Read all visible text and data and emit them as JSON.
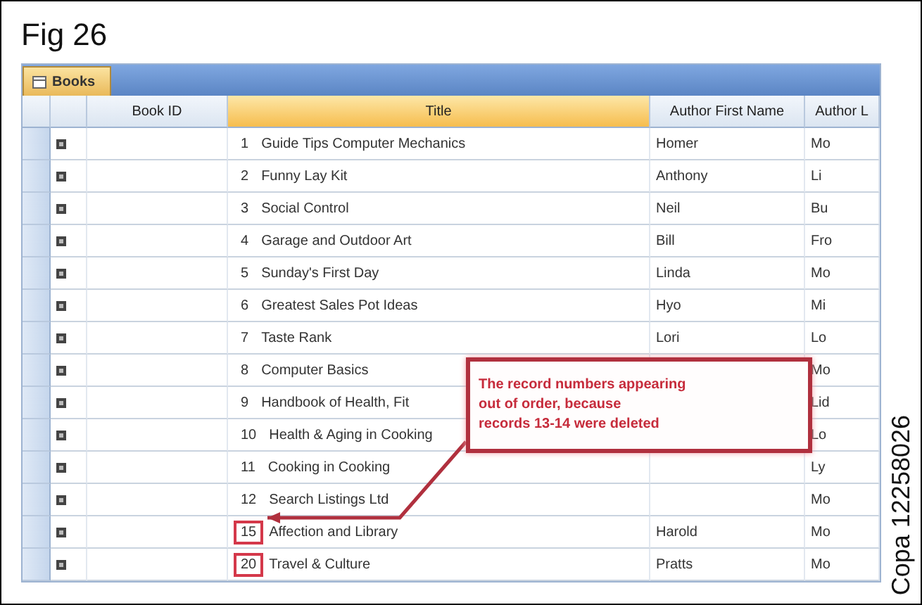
{
  "figure": {
    "title": "Fig 26",
    "code": "Copa 12258026"
  },
  "table": {
    "tab": "Books",
    "columns": [
      {
        "label": "Book ID",
        "selected": false
      },
      {
        "label": "Title",
        "selected": true
      },
      {
        "label": "Author First Name",
        "selected": false
      },
      {
        "label": "Author L",
        "selected": false
      }
    ],
    "rows": [
      {
        "number": "1",
        "title": "Guide Tips Computer Mechanics",
        "first": "Homer",
        "last": "Mo",
        "highlighted": false
      },
      {
        "number": "2",
        "title": "Funny Lay Kit",
        "first": "Anthony",
        "last": "Li",
        "highlighted": false
      },
      {
        "number": "3",
        "title": "Social Control",
        "first": "Neil",
        "last": "Bu",
        "highlighted": false
      },
      {
        "number": "4",
        "title": "Garage and Outdoor Art",
        "first": "Bill",
        "last": "Fro",
        "highlighted": false
      },
      {
        "number": "5",
        "title": "Sunday's First Day",
        "first": "Linda",
        "last": "Mo",
        "highlighted": false
      },
      {
        "number": "6",
        "title": "Greatest Sales Pot Ideas",
        "first": "Hyo",
        "last": "Mi",
        "highlighted": false
      },
      {
        "number": "7",
        "title": "Taste Rank",
        "first": "Lori",
        "last": "Lo",
        "highlighted": false
      },
      {
        "number": "8",
        "title": "Computer Basics",
        "first": "",
        "last": "Mo",
        "highlighted": false
      },
      {
        "number": "9",
        "title": "Handbook of Health, Fit",
        "first": "",
        "last": "Lid",
        "highlighted": false
      },
      {
        "number": "10",
        "title": "Health & Aging in Cooking",
        "first": "",
        "last": "Lo",
        "highlighted": false
      },
      {
        "number": "11",
        "title": "Cooking in Cooking",
        "first": "",
        "last": "Ly",
        "highlighted": false
      },
      {
        "number": "12",
        "title": "Search Listings Ltd",
        "first": "",
        "last": "Mo",
        "highlighted": false
      },
      {
        "number": "15",
        "title": "Affection and Library",
        "first": "Harold",
        "last": "Mo",
        "highlighted": true
      },
      {
        "number": "20",
        "title": "Travel & Culture",
        "first": "Pratts",
        "last": "Mo",
        "highlighted": true
      }
    ]
  },
  "callout": {
    "lines": [
      "The record numbers appearing",
      "out of order, because",
      "records 13-14 were deleted"
    ]
  }
}
